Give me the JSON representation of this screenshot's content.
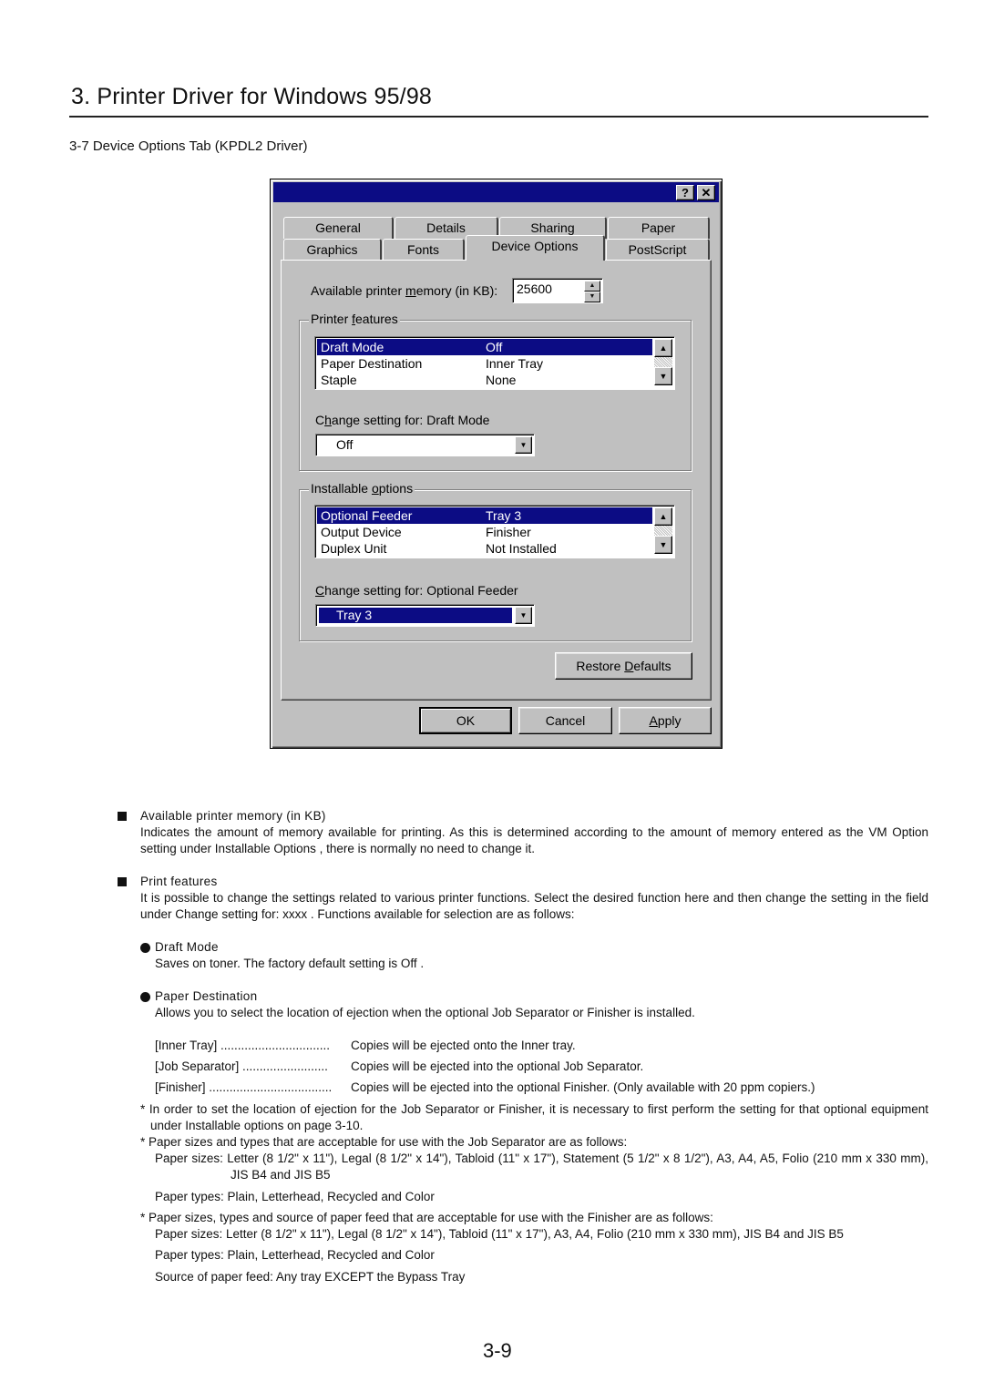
{
  "page": {
    "title": "3. Printer Driver for Windows 95/98",
    "section_title": "3-7 Device Options Tab (KPDL2 Driver)",
    "page_number": "3-9"
  },
  "dialog": {
    "title": "",
    "help_button": "?",
    "close_button": "✕",
    "tabs_row1": [
      "General",
      "Details",
      "Sharing",
      "Paper"
    ],
    "tabs_row2": [
      "Graphics",
      "Fonts",
      "Device Options",
      "PostScript"
    ],
    "active_tab": "Device Options",
    "memory": {
      "label_pre": "Available printer ",
      "label_ul": "m",
      "label_post": "emory (in KB):",
      "value": "25600"
    },
    "printer_features": {
      "group_pre": "Printer ",
      "group_ul": "f",
      "group_post": "eatures",
      "items": [
        {
          "name": "Draft Mode",
          "value": "Off",
          "selected": true
        },
        {
          "name": "Paper Destination",
          "value": "Inner Tray",
          "selected": false
        },
        {
          "name": "Staple",
          "value": "None",
          "selected": false
        }
      ],
      "change_pre": "C",
      "change_ul": "h",
      "change_post": "ange setting for:  Draft Mode",
      "combo_value": "Off"
    },
    "installable_options": {
      "group_pre": "Installable ",
      "group_ul": "o",
      "group_post": "ptions",
      "items": [
        {
          "name": "Optional Feeder",
          "value": "Tray 3",
          "selected": true
        },
        {
          "name": "Output Device",
          "value": "Finisher",
          "selected": false
        },
        {
          "name": "Duplex Unit",
          "value": "Not Installed",
          "selected": false
        }
      ],
      "change_pre": "",
      "change_ul": "C",
      "change_post": "hange setting for:  Optional Feeder",
      "combo_value": "Tray 3"
    },
    "restore_pre": "Restore ",
    "restore_ul": "D",
    "restore_post": "efaults",
    "ok_label": "OK",
    "cancel_label": "Cancel",
    "apply_ul": "A",
    "apply_post": "pply",
    "colors": {
      "titlebar": "#0c0c84",
      "face": "#c0c0c0",
      "selection": "#0c0c84"
    }
  },
  "body": {
    "memory_heading": "Available printer memory (in KB)",
    "memory_text": "Indicates the amount of memory available for printing. As this is determined according to the amount of memory entered as the  VM Option  setting under  Installable Options , there is normally no need to change it.",
    "features_heading": "Print features",
    "features_text": "It is possible to change the settings related to various printer functions. Select the desired function here and then change the setting in the field under  Change setting for: xxxx . Functions available for selection are as follows:",
    "draft_heading": "Draft Mode",
    "draft_text": "Saves on toner. The factory default setting is  Off .",
    "dest_heading": "Paper Destination",
    "dest_text": "Allows you to select the location of ejection when the optional Job Separator or Finisher is installed.",
    "dest_options": [
      {
        "key": "[Inner Tray] ................................",
        "desc": "Copies will be ejected onto the Inner tray."
      },
      {
        "key": "[Job Separator] .........................",
        "desc": "Copies will be ejected into the optional Job Separator."
      },
      {
        "key": "[Finisher] ....................................",
        "desc": "Copies will be ejected into the optional Finisher. (Only available with 20 ppm copiers.)"
      }
    ],
    "note1": "* In order to set the location of ejection for the Job Separator or Finisher, it is necessary to first perform the setting for that optional equipment under  Installable options  on page 3-10.",
    "note2": "* Paper sizes and types that are acceptable for use with the Job Separator are as follows:",
    "js_sizes_label": "Paper sizes: ",
    "js_sizes": "Letter (8 1/2\" x 11\"), Legal (8 1/2\" x 14\"), Tabloid (11\" x 17\"), Statement (5 1/2\" x 8 1/2\"), A3, A4, A5, Folio (210 mm x 330 mm), JIS B4 and JIS B5",
    "js_types": "Paper types: Plain, Letterhead, Recycled and Color",
    "note3": "* Paper sizes, types and source of paper feed that are acceptable for use with the Finisher are as follows:",
    "fin_sizes": "Paper sizes: Letter (8 1/2\" x 11\"), Legal (8 1/2\" x 14\"), Tabloid (11\" x 17\"), A3, A4, Folio (210 mm x 330 mm), JIS B4 and JIS B5",
    "fin_types": "Paper types: Plain, Letterhead, Recycled and Color",
    "fin_source": "Source of paper feed: Any tray EXCEPT the Bypass Tray"
  }
}
